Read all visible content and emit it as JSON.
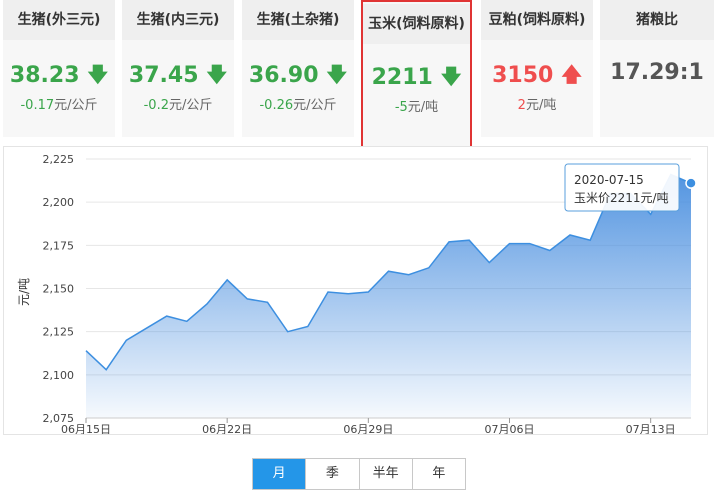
{
  "cards": [
    {
      "title": "生猪(外三元)",
      "price": "38.23",
      "direction": "down",
      "change": "-0.17",
      "unit": "元/公斤"
    },
    {
      "title": "生猪(内三元)",
      "price": "37.45",
      "direction": "down",
      "change": "-0.2",
      "unit": "元/公斤"
    },
    {
      "title": "生猪(土杂猪)",
      "price": "36.90",
      "direction": "down",
      "change": "-0.26",
      "unit": "元/公斤"
    },
    {
      "title": "玉米(饲料原料)",
      "price": "2211",
      "direction": "down",
      "change": "-5",
      "unit": "元/吨",
      "highlighted": true
    },
    {
      "title": "豆粕(饲料原料)",
      "price": "3150",
      "direction": "up",
      "change": "2",
      "unit": "元/吨"
    },
    {
      "title": "猪粮比",
      "price": "17.29:1",
      "direction": "none",
      "change": "",
      "unit": ""
    }
  ],
  "chart_data": {
    "type": "area",
    "ylabel": "元/吨",
    "ylim": [
      2075,
      2225
    ],
    "yticks": [
      "2,075",
      "2,100",
      "2,125",
      "2,150",
      "2,175",
      "2,200",
      "2,225"
    ],
    "xtick_labels": [
      {
        "label": "06月15日",
        "index": 0
      },
      {
        "label": "06月22日",
        "index": 7
      },
      {
        "label": "06月29日",
        "index": 14
      },
      {
        "label": "07月06日",
        "index": 21
      },
      {
        "label": "07月13日",
        "index": 28
      }
    ],
    "x": [
      "2020-06-15",
      "2020-06-16",
      "2020-06-17",
      "2020-06-18",
      "2020-06-19",
      "2020-06-20",
      "2020-06-21",
      "2020-06-22",
      "2020-06-23",
      "2020-06-24",
      "2020-06-25",
      "2020-06-26",
      "2020-06-27",
      "2020-06-28",
      "2020-06-29",
      "2020-06-30",
      "2020-07-01",
      "2020-07-02",
      "2020-07-03",
      "2020-07-04",
      "2020-07-05",
      "2020-07-06",
      "2020-07-07",
      "2020-07-08",
      "2020-07-09",
      "2020-07-10",
      "2020-07-11",
      "2020-07-12",
      "2020-07-13",
      "2020-07-14",
      "2020-07-15"
    ],
    "series": [
      {
        "values": [
          2114,
          2103,
          2120,
          2127,
          2134,
          2131,
          2141,
          2155,
          2144,
          2142,
          2125,
          2128,
          2148,
          2147,
          2148,
          2160,
          2158,
          2162,
          2177,
          2178,
          2165,
          2176,
          2176,
          2172,
          2181,
          2178,
          2205,
          2205,
          2193,
          2216,
          2211
        ]
      }
    ],
    "grid": true,
    "tooltip": {
      "date": "2020-07-15",
      "text": "玉米价2211元/吨"
    }
  },
  "colors": {
    "line": "#3d8fe0",
    "area_top": "#4a90e2",
    "up": "#ef4e4e",
    "down": "#3aa54b",
    "active_tab": "#2496e8"
  },
  "range_tabs": [
    {
      "label": "月",
      "active": true
    },
    {
      "label": "季",
      "active": false
    },
    {
      "label": "半年",
      "active": false
    },
    {
      "label": "年",
      "active": false
    }
  ]
}
